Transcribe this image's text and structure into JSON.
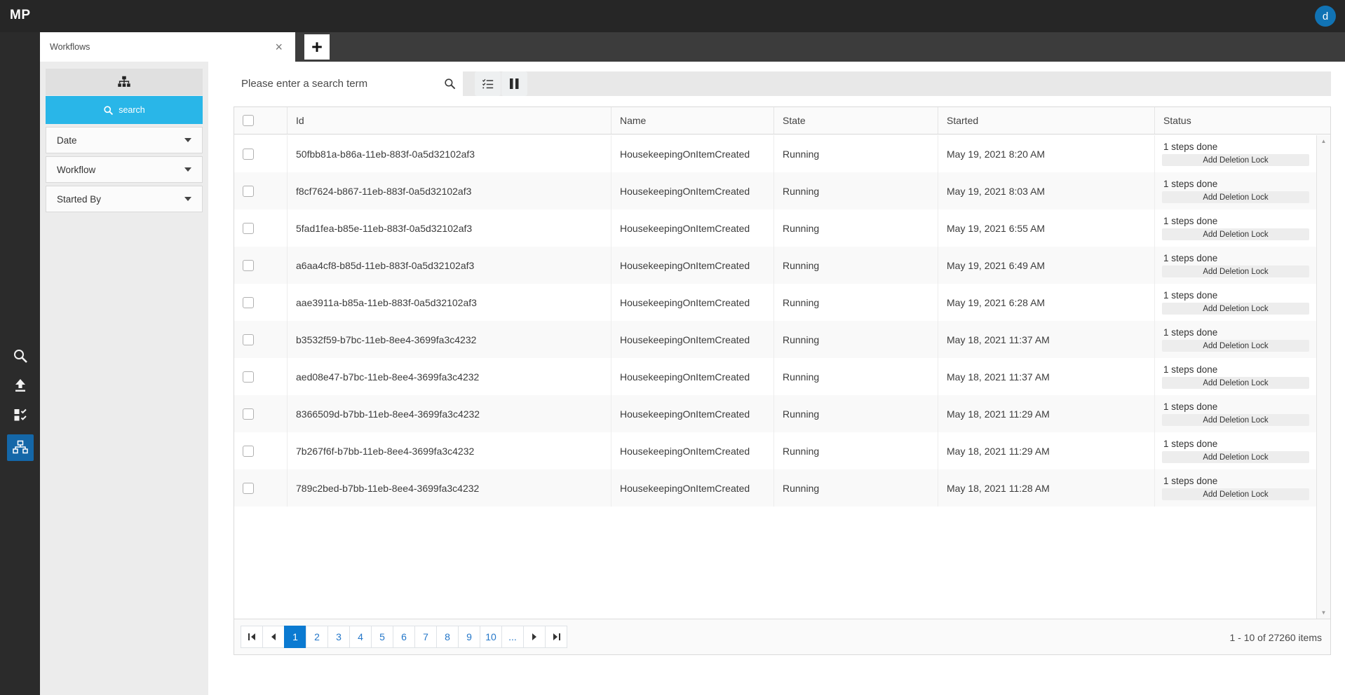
{
  "topbar": {
    "logo": "MP",
    "avatar_initial": "d"
  },
  "tab_bar": {
    "active_tab_label": "Workflows",
    "close_glyph": "×",
    "new_tab_glyph": "+"
  },
  "nav_rail": {
    "icons": [
      "search-icon",
      "upload-icon",
      "checklist-icon",
      "workflow-icon"
    ],
    "active_icon": "workflow-icon"
  },
  "filter_panel": {
    "header_icon": "hierarchy-icon",
    "search_button_label": "search",
    "sections": [
      {
        "label": "Date"
      },
      {
        "label": "Workflow"
      },
      {
        "label": "Started By"
      }
    ]
  },
  "toolbar": {
    "search_placeholder": "Please enter a search term",
    "buttons": [
      "checklist-icon",
      "pause-icon"
    ]
  },
  "grid": {
    "columns": {
      "id": "Id",
      "name": "Name",
      "state": "State",
      "started": "Started",
      "status": "Status"
    },
    "rows": [
      {
        "id": "50fbb81a-b86a-11eb-883f-0a5d32102af3",
        "name": "HousekeepingOnItemCreated",
        "state": "Running",
        "started": "May 19, 2021 8:20 AM",
        "status": "1 steps done",
        "action": "Add Deletion Lock"
      },
      {
        "id": "f8cf7624-b867-11eb-883f-0a5d32102af3",
        "name": "HousekeepingOnItemCreated",
        "state": "Running",
        "started": "May 19, 2021 8:03 AM",
        "status": "1 steps done",
        "action": "Add Deletion Lock"
      },
      {
        "id": "5fad1fea-b85e-11eb-883f-0a5d32102af3",
        "name": "HousekeepingOnItemCreated",
        "state": "Running",
        "started": "May 19, 2021 6:55 AM",
        "status": "1 steps done",
        "action": "Add Deletion Lock"
      },
      {
        "id": "a6aa4cf8-b85d-11eb-883f-0a5d32102af3",
        "name": "HousekeepingOnItemCreated",
        "state": "Running",
        "started": "May 19, 2021 6:49 AM",
        "status": "1 steps done",
        "action": "Add Deletion Lock"
      },
      {
        "id": "aae3911a-b85a-11eb-883f-0a5d32102af3",
        "name": "HousekeepingOnItemCreated",
        "state": "Running",
        "started": "May 19, 2021 6:28 AM",
        "status": "1 steps done",
        "action": "Add Deletion Lock"
      },
      {
        "id": "b3532f59-b7bc-11eb-8ee4-3699fa3c4232",
        "name": "HousekeepingOnItemCreated",
        "state": "Running",
        "started": "May 18, 2021 11:37 AM",
        "status": "1 steps done",
        "action": "Add Deletion Lock"
      },
      {
        "id": "aed08e47-b7bc-11eb-8ee4-3699fa3c4232",
        "name": "HousekeepingOnItemCreated",
        "state": "Running",
        "started": "May 18, 2021 11:37 AM",
        "status": "1 steps done",
        "action": "Add Deletion Lock"
      },
      {
        "id": "8366509d-b7bb-11eb-8ee4-3699fa3c4232",
        "name": "HousekeepingOnItemCreated",
        "state": "Running",
        "started": "May 18, 2021 11:29 AM",
        "status": "1 steps done",
        "action": "Add Deletion Lock"
      },
      {
        "id": "7b267f6f-b7bb-11eb-8ee4-3699fa3c4232",
        "name": "HousekeepingOnItemCreated",
        "state": "Running",
        "started": "May 18, 2021 11:29 AM",
        "status": "1 steps done",
        "action": "Add Deletion Lock"
      },
      {
        "id": "789c2bed-b7bb-11eb-8ee4-3699fa3c4232",
        "name": "HousekeepingOnItemCreated",
        "state": "Running",
        "started": "May 18, 2021 11:28 AM",
        "status": "1 steps done",
        "action": "Add Deletion Lock"
      }
    ]
  },
  "pager": {
    "pages": [
      "1",
      "2",
      "3",
      "4",
      "5",
      "6",
      "7",
      "8",
      "9",
      "10",
      "..."
    ],
    "active_page": "1",
    "info": "1 - 10 of 27260 items"
  },
  "colors": {
    "accent_cyan": "#29b6e8",
    "pager_active_blue": "#0b7ad1",
    "rail_active_blue": "#1467a8",
    "avatar_blue": "#1173b4"
  }
}
